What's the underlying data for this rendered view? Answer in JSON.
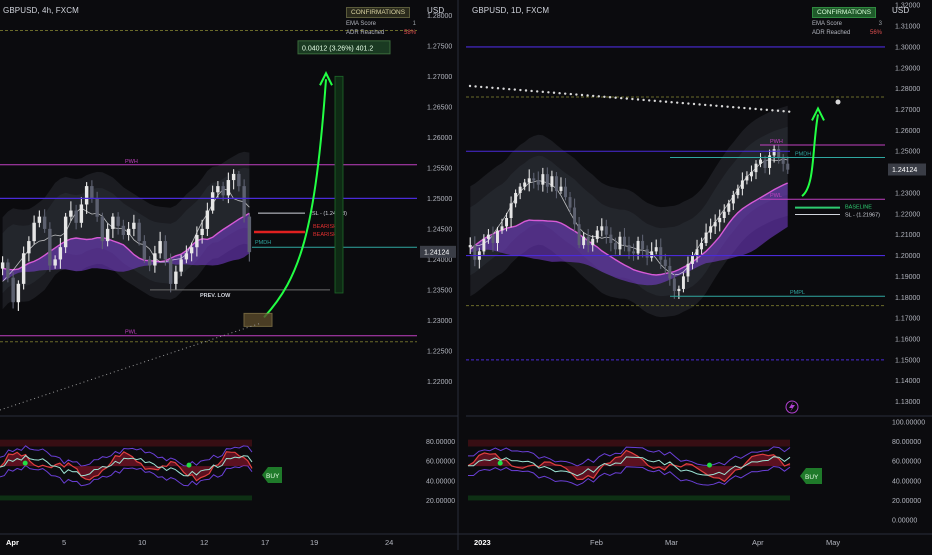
{
  "left_chart": {
    "symbol": "GBPUSD, 4h, FXCM",
    "currency": "USD",
    "confirmations": {
      "title": "CONFIRMATIONS",
      "rows": [
        {
          "label": "EMA Score",
          "value": "1"
        },
        {
          "label": "ADR Reached",
          "value": "58%"
        }
      ]
    },
    "price_ticks": [
      "1.28000",
      "1.27500",
      "1.27000",
      "1.26500",
      "1.26000",
      "1.25500",
      "1.25000",
      "1.24500",
      "1.24000",
      "1.23500",
      "1.23000",
      "1.22500",
      "1.22000"
    ],
    "last_price": "1.24124",
    "measure_label": "0.04012 (3.26%) 401.2",
    "levels": [
      {
        "label": "PWH",
        "color": "#c040c0"
      },
      {
        "label": "PWL",
        "color": "#c040c0"
      },
      {
        "label": "PMDH",
        "color": "#2fa7a0"
      },
      {
        "label": "SL - (1.24758)",
        "color": "#d1d4dc"
      },
      {
        "label": "PREV. LOW",
        "color": "#d1d4dc"
      }
    ],
    "signal_labels": [
      "BEARISH",
      "BEARISH"
    ],
    "x_ticks": [
      "Apr",
      "5",
      "10",
      "12",
      "17",
      "19",
      "24"
    ],
    "osc_ticks": [
      "80.00000",
      "60.00000",
      "40.00000",
      "20.00000"
    ],
    "buy_label": "BUY"
  },
  "right_chart": {
    "symbol": "GBPUSD, 1D, FXCM",
    "currency": "USD",
    "confirmations": {
      "title": "CONFIRMATIONS",
      "rows": [
        {
          "label": "EMA Score",
          "value": "3"
        },
        {
          "label": "ADR Reached",
          "value": "56%"
        }
      ]
    },
    "price_ticks": [
      "1.32000",
      "1.31000",
      "1.30000",
      "1.29000",
      "1.28000",
      "1.27000",
      "1.26000",
      "1.25000",
      "1.24000",
      "1.23000",
      "1.22000",
      "1.21000",
      "1.20000",
      "1.19000",
      "1.18000",
      "1.17000",
      "1.16000",
      "1.15000",
      "1.14000",
      "1.13000"
    ],
    "last_price": "1.24124",
    "levels": [
      {
        "label": "PWH",
        "color": "#c040c0"
      },
      {
        "label": "PMDH",
        "color": "#2fa7a0"
      },
      {
        "label": "PWL",
        "color": "#c040c0"
      },
      {
        "label": "PMPL",
        "color": "#2fa7a0"
      },
      {
        "label": "BASELINE",
        "color": "#2ecc71"
      },
      {
        "label": "SL - (1.21967)",
        "color": "#d1d4dc"
      }
    ],
    "x_ticks": [
      "2023",
      "Feb",
      "Mar",
      "Apr",
      "May"
    ],
    "osc_ticks": [
      "100.00000",
      "80.00000",
      "60.00000",
      "40.00000",
      "20.00000",
      "0.00000"
    ],
    "buy_label": "BUY"
  },
  "chart_data": [
    {
      "type": "candlestick",
      "title": "GBPUSD, 4h, FXCM",
      "ylabel": "USD",
      "ylim": [
        1.215,
        1.2825
      ],
      "x_ticks": [
        "Apr",
        "5",
        "10",
        "12",
        "17",
        "19",
        "24"
      ],
      "close": [
        1.2395,
        1.237,
        1.233,
        1.236,
        1.241,
        1.243,
        1.246,
        1.247,
        1.245,
        1.239,
        1.24,
        1.242,
        1.247,
        1.248,
        1.246,
        1.249,
        1.252,
        1.25,
        1.247,
        1.243,
        1.245,
        1.247,
        1.2455,
        1.244,
        1.245,
        1.246,
        1.243,
        1.24,
        1.239,
        1.241,
        1.243,
        1.24,
        1.236,
        1.238,
        1.24,
        1.241,
        1.242,
        1.244,
        1.245,
        1.248,
        1.251,
        1.252,
        1.2505,
        1.253,
        1.254,
        1.252,
        1.247,
        1.2412
      ],
      "last_price": 1.24124,
      "levels": {
        "PWH": 1.2555,
        "PWL": 1.2275,
        "PMDH": 1.242,
        "SL": 1.24758,
        "PREV_LOW": 1.235
      },
      "projection": {
        "from": 1.2305,
        "to": 1.2705,
        "change": "0.04012 (3.26%) 401.2"
      }
    },
    {
      "type": "candlestick",
      "title": "GBPUSD, 1D, FXCM",
      "ylabel": "USD",
      "ylim": [
        1.125,
        1.3225
      ],
      "x_ticks": [
        "2023",
        "Feb",
        "Mar",
        "Apr",
        "May"
      ],
      "close": [
        1.205,
        1.198,
        1.202,
        1.208,
        1.21,
        1.206,
        1.212,
        1.214,
        1.218,
        1.225,
        1.23,
        1.233,
        1.235,
        1.237,
        1.236,
        1.234,
        1.239,
        1.233,
        1.238,
        1.231,
        1.233,
        1.228,
        1.223,
        1.215,
        1.205,
        1.209,
        1.205,
        1.208,
        1.212,
        1.214,
        1.21,
        1.206,
        1.203,
        1.209,
        1.205,
        1.202,
        1.201,
        1.207,
        1.203,
        1.199,
        1.202,
        1.204,
        1.198,
        1.195,
        1.189,
        1.183,
        1.184,
        1.19,
        1.196,
        1.2,
        1.203,
        1.206,
        1.211,
        1.214,
        1.216,
        1.218,
        1.221,
        1.225,
        1.229,
        1.232,
        1.236,
        1.238,
        1.24,
        1.244,
        1.246,
        1.242,
        1.248,
        1.251,
        1.247,
        1.244,
        1.2412
      ],
      "last_price": 1.24124,
      "levels": {
        "PWH": 1.253,
        "PWL": 1.227,
        "PMDH": 1.247,
        "PMPL": 1.1805,
        "BASELINE": 1.223,
        "SL": 1.21967
      },
      "projection": {
        "from": 1.2285,
        "to": 1.2705
      }
    }
  ]
}
